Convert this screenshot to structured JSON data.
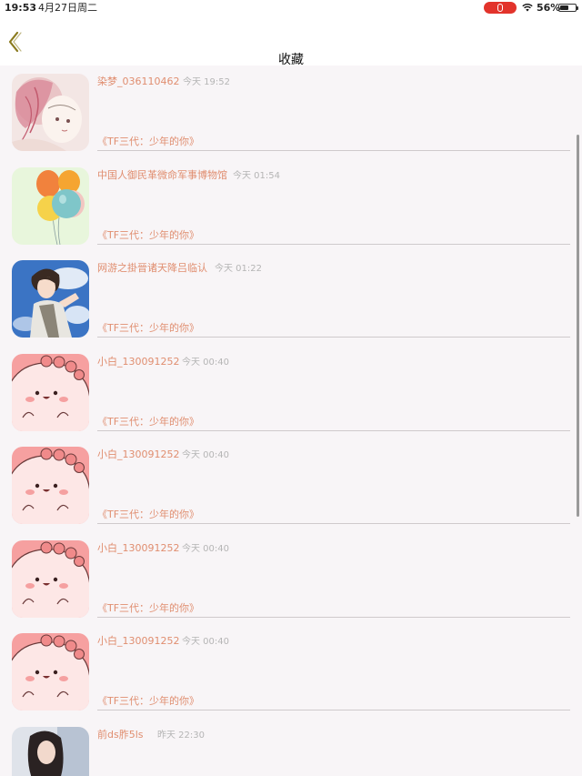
{
  "status_bar": {
    "time": "19:53",
    "date": "4月27日周二",
    "battery": "56%",
    "battery_level": 0.56
  },
  "nav": {
    "title": "收藏",
    "back_icon": "chevron-left-icon",
    "accent": "#8a7a1e"
  },
  "items": [
    {
      "name": "染梦_036110462",
      "time": "今天 19:52",
      "work": "《TF三代：少年的你》",
      "avatar": "anime-girl-pink-hair"
    },
    {
      "name": "中国人御民革微命军事博物馆",
      "time": "今天 01:54",
      "work": "《TF三代：少年的你》",
      "avatar": "balloons"
    },
    {
      "name": "网游之掛晉诸天降吕临认",
      "time": "今天 01:22",
      "work": "《TF三代：少年的你》",
      "avatar": "anime-boy-sky"
    },
    {
      "name": "小白_130091252",
      "time": "今天 00:40",
      "work": "《TF三代：少年的你》",
      "avatar": "pink-blob"
    },
    {
      "name": "小白_130091252",
      "time": "今天 00:40",
      "work": "《TF三代：少年的你》",
      "avatar": "pink-blob"
    },
    {
      "name": "小白_130091252",
      "time": "今天 00:40",
      "work": "《TF三代：少年的你》",
      "avatar": "pink-blob"
    },
    {
      "name": "小白_130091252",
      "time": "今天 00:40",
      "work": "《TF三代：少年的你》",
      "avatar": "pink-blob"
    },
    {
      "name": "前ds胙5ls",
      "time": "昨天 22:30",
      "work": "",
      "avatar": "girl-photo"
    }
  ],
  "colors": {
    "name_text": "#e08e70",
    "time_text": "#b5b5b5",
    "background": "#f8f5f7"
  }
}
